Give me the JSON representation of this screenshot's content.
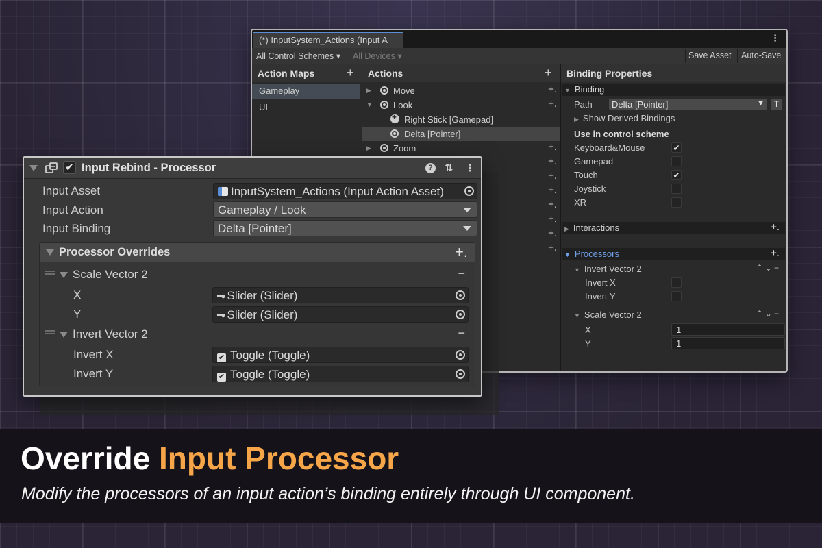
{
  "editor": {
    "tab_title": "(*) InputSystem_Actions (Input A",
    "menu_glyph": "⋮",
    "toolbar": {
      "control_schemes": "All Control Schemes",
      "devices": "All Devices",
      "save_asset": "Save Asset",
      "auto_save": "Auto-Save"
    },
    "action_maps": {
      "header": "Action Maps",
      "items": [
        "Gameplay",
        "UI"
      ],
      "selected": "Gameplay"
    },
    "actions": {
      "header": "Actions",
      "rows": [
        {
          "label": "Move",
          "kind": "action",
          "expanded": false
        },
        {
          "label": "Look",
          "kind": "action",
          "expanded": true
        },
        {
          "label": "Right Stick [Gamepad]",
          "kind": "binding-gamepad"
        },
        {
          "label": "Delta [Pointer]",
          "kind": "binding-pointer",
          "selected": true
        },
        {
          "label": "Zoom",
          "kind": "action",
          "expanded": false
        }
      ]
    },
    "binding_properties": {
      "header": "Binding Properties",
      "binding_section": "Binding",
      "path_label": "Path",
      "path_value": "Delta [Pointer]",
      "t_button": "T",
      "show_derived": "Show Derived Bindings",
      "use_in_scheme": "Use in control scheme",
      "schemes": [
        {
          "name": "Keyboard&Mouse",
          "checked": true
        },
        {
          "name": "Gamepad",
          "checked": false
        },
        {
          "name": "Touch",
          "checked": true
        },
        {
          "name": "Joystick",
          "checked": false
        },
        {
          "name": "XR",
          "checked": false
        }
      ],
      "interactions": "Interactions",
      "processors": "Processors",
      "invert_vector": "Invert Vector 2",
      "invert_x": "Invert X",
      "invert_y": "Invert Y",
      "scale_vector": "Scale Vector 2",
      "scale_x_label": "X",
      "scale_x_value": "1",
      "scale_y_label": "Y",
      "scale_y_value": "1"
    }
  },
  "inspector": {
    "title": "Input Rebind - Processor",
    "enabled": true,
    "fields": {
      "input_asset_label": "Input Asset",
      "input_asset_value": "InputSystem_Actions (Input Action Asset)",
      "input_action_label": "Input Action",
      "input_action_value": "Gameplay / Look",
      "input_binding_label": "Input Binding",
      "input_binding_value": "Delta [Pointer]"
    },
    "processor_overrides": {
      "header": "Processor Overrides",
      "scale": {
        "title": "Scale Vector 2",
        "x_label": "X",
        "x_value": "Slider (Slider)",
        "y_label": "Y",
        "y_value": "Slider (Slider)"
      },
      "invert": {
        "title": "Invert Vector 2",
        "x_label": "Invert X",
        "x_value": "Toggle (Toggle)",
        "y_label": "Invert Y",
        "y_value": "Toggle (Toggle)"
      }
    }
  },
  "banner": {
    "title_main": "Override",
    "title_accent": "Input Processor",
    "subtitle": "Modify the processors of an input action’s binding entirely through UI component."
  },
  "colors": {
    "accent_orange": "#f6a548",
    "selection_blue": "#5a8fd8",
    "background": "#2c2638"
  }
}
